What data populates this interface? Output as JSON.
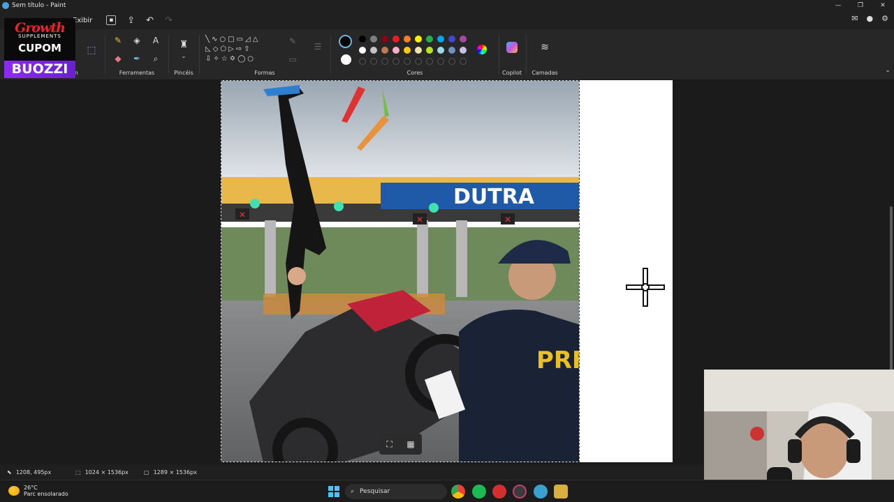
{
  "window": {
    "title": "Sem título - Paint",
    "controls": [
      "—",
      "❐",
      "✕"
    ]
  },
  "menu": {
    "view_label": "Exibir"
  },
  "ribbon": {
    "groups": {
      "image_suffix": "m",
      "tools": "Ferramentas",
      "brushes": "Pincéis",
      "shapes": "Formas",
      "colors": "Cores",
      "copilot": "Copilot",
      "layers": "Camadas"
    },
    "palette_row1": [
      "#000000",
      "#7f7f7f",
      "#880015",
      "#ed1c24",
      "#ff7f27",
      "#fff200",
      "#22b14c",
      "#00a2e8",
      "#3f48cc",
      "#a349a4"
    ],
    "palette_row2": [
      "#ffffff",
      "#c3c3c3",
      "#b97a57",
      "#ffaec9",
      "#ffc90e",
      "#efe4b0",
      "#b5e61d",
      "#99d9ea",
      "#7092be",
      "#c8bfe7"
    ]
  },
  "ad": {
    "brand": "Growth",
    "brand_sub": "SUPPLEMENTS",
    "cupom": "CUPOM",
    "code": "BUOZZI"
  },
  "photo": {
    "sign_text": "DUTRA",
    "badge_text": "PRF"
  },
  "statusbar": {
    "cursor_pos": "1208, 495px",
    "selection_size": "1024 × 1536px",
    "canvas_size": "1289 × 1536px"
  },
  "taskbar": {
    "temperature": "26°C",
    "weather_desc": "Parc ensolarado",
    "search_placeholder": "Pesquisar"
  }
}
